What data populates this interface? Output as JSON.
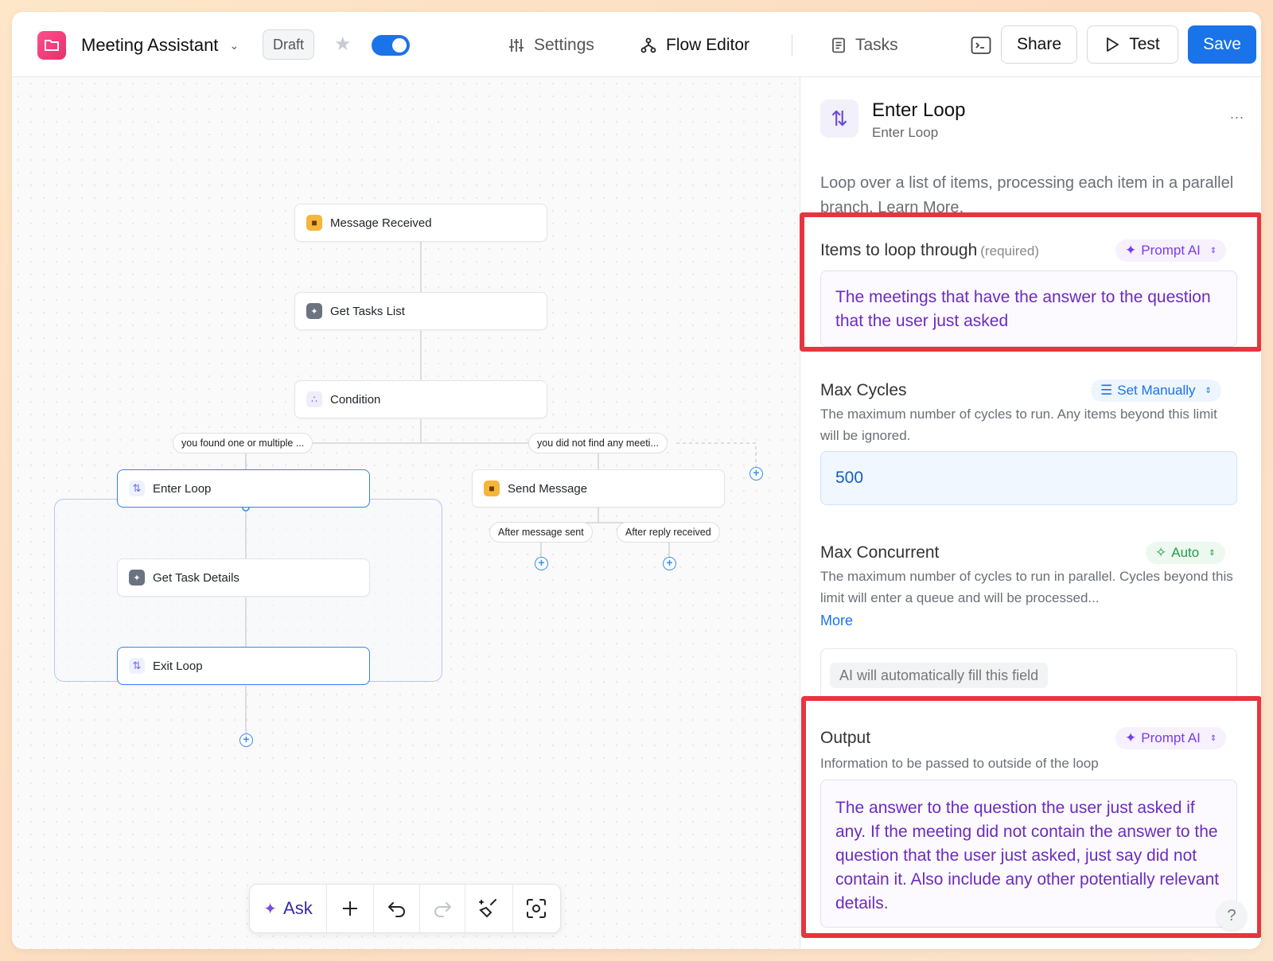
{
  "header": {
    "app_title": "Meeting Assistant",
    "draft_label": "Draft",
    "nav": {
      "settings": "Settings",
      "flow_editor": "Flow Editor",
      "tasks": "Tasks"
    },
    "share_label": "Share",
    "test_label": "Test",
    "save_label": "Save",
    "accent_color": "#1a73e8"
  },
  "flow": {
    "nodes": {
      "message_received": "Message Received",
      "get_tasks_list": "Get Tasks List",
      "condition": "Condition",
      "enter_loop": "Enter Loop",
      "get_task_details": "Get Task Details",
      "exit_loop": "Exit Loop",
      "send_message": "Send Message"
    },
    "edges": {
      "branch_found": "you found one or multiple ...",
      "branch_not_found": "you did not find any meeti...",
      "after_sent": "After message sent",
      "after_reply": "After reply received"
    }
  },
  "toolbar": {
    "ask_label": "Ask"
  },
  "panel": {
    "title": "Enter Loop",
    "subtitle": "Enter Loop",
    "more": "...",
    "description": "Loop over a list of items, processing each item in a parallel branch.",
    "learn_more": "Learn More",
    "description_end": ".",
    "items": {
      "label": "Items to loop through",
      "required": "(required)",
      "mode": "Prompt AI",
      "value": "The meetings that have the answer to the question that the user just asked"
    },
    "max_cycles": {
      "label": "Max Cycles",
      "mode": "Set Manually",
      "help": "The maximum number of cycles to run. Any items beyond this limit will be ignored.",
      "value": "500"
    },
    "max_concurrent": {
      "label": "Max Concurrent",
      "mode": "Auto",
      "help": "The maximum number of cycles to run in parallel. Cycles beyond this limit will enter a queue and will be processed...",
      "more": "More",
      "placeholder": "AI will automatically fill this field"
    },
    "output": {
      "label": "Output",
      "mode": "Prompt AI",
      "help": "Information to be passed to outside of the loop",
      "value": "The answer to the question the user just asked if any. If the meeting did not contain the answer to the question that the user just asked, just say did not contain it. Also include any other potentially relevant details."
    },
    "help_glyph": "?"
  },
  "highlight_color": "#e8343f"
}
